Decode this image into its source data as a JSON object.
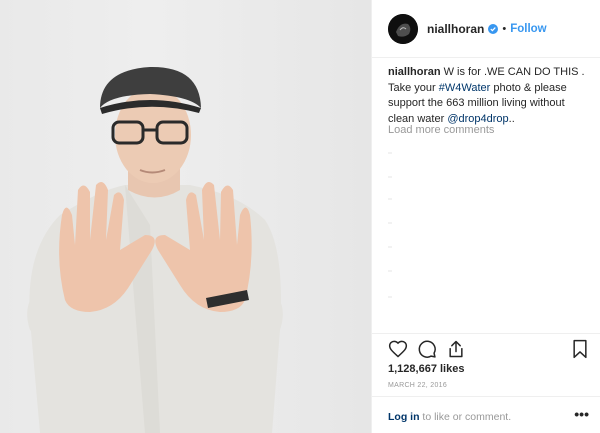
{
  "post": {
    "username": "niallhoran",
    "follow_label": "Follow",
    "separator": "•",
    "caption": {
      "username": "niallhoran",
      "text_part1": " W is for .WE CAN DO THIS . Take your ",
      "hashtag": "#W4Water",
      "text_part2": " photo & please support the 663 million living without clean water ",
      "mention": "@drop4drop",
      "text_end": ".."
    },
    "load_more_label": "Load more comments",
    "likes_text": "1,128,667 likes",
    "date_text": "MARCH 22, 2016",
    "login_link": "Log in",
    "login_rest": " to like or comment.",
    "more_label": "•••"
  },
  "icons": {
    "avatar": "profile-avatar",
    "verified": "verified-badge-icon",
    "like": "heart-icon",
    "comment": "comment-bubble-icon",
    "share": "share-upload-icon",
    "save": "bookmark-icon"
  },
  "colors": {
    "link_blue": "#3897f0",
    "text": "#262626",
    "muted": "#999999",
    "verified": "#3897f0"
  }
}
